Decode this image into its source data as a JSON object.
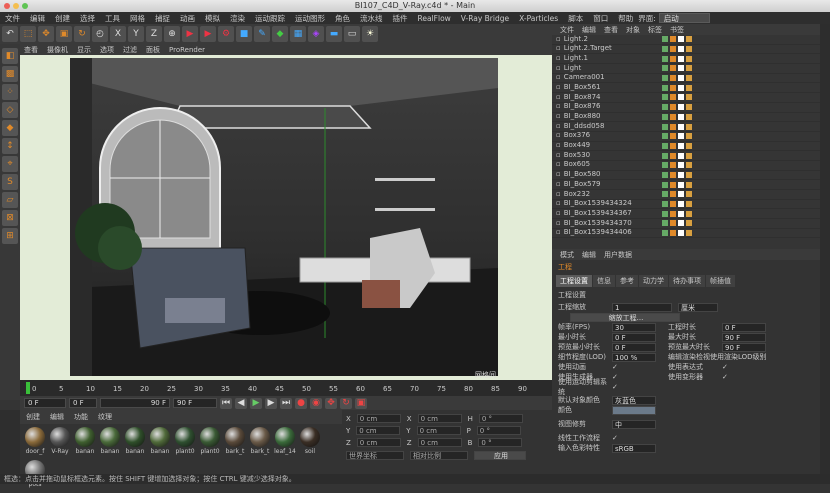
{
  "window": {
    "title": "BI107_C4D_V-Ray.c4d * - Main"
  },
  "menu": {
    "items": [
      "文件",
      "编辑",
      "创建",
      "选择",
      "工具",
      "网格",
      "捕捉",
      "动画",
      "模拟",
      "渲染",
      "运动跟踪",
      "运动图形",
      "角色",
      "流水线",
      "插件",
      "RealFlow",
      "V-Ray Bridge",
      "X-Particles",
      "脚本",
      "窗口",
      "帮助"
    ],
    "layout_label": "界面:",
    "layout_value": "启动"
  },
  "viewport": {
    "menu": [
      "查看",
      "摄像机",
      "显示",
      "选项",
      "过滤",
      "面板",
      "ProRender"
    ],
    "watermark": "网格间"
  },
  "timeline": {
    "ticks": [
      "0",
      "5",
      "10",
      "15",
      "20",
      "25",
      "30",
      "35",
      "40",
      "45",
      "50",
      "55",
      "60",
      "65",
      "70",
      "75",
      "80",
      "85",
      "90"
    ],
    "start": "0 F",
    "current": "0 F",
    "end": "90 F",
    "end2": "90 F"
  },
  "materials": {
    "menu": [
      "创建",
      "编辑",
      "功能",
      "纹理"
    ],
    "items": [
      {
        "name": "door_f",
        "color": "#8a6a3a"
      },
      {
        "name": "V-Ray",
        "color": "#555"
      },
      {
        "name": "banan",
        "color": "#3f5f2f"
      },
      {
        "name": "banan",
        "color": "#4a6a3a"
      },
      {
        "name": "banan",
        "color": "#2f4f2a"
      },
      {
        "name": "banan",
        "color": "#506a3a"
      },
      {
        "name": "plant0",
        "color": "#2f5030"
      },
      {
        "name": "plant0",
        "color": "#3a5a34"
      },
      {
        "name": "bark_t",
        "color": "#5a4a3a"
      },
      {
        "name": "bark_t",
        "color": "#6a5a48"
      },
      {
        "name": "leaf_14",
        "color": "#3a6a3a"
      },
      {
        "name": "soil",
        "color": "#3a2e24"
      },
      {
        "name": "pots",
        "color": "#777"
      }
    ]
  },
  "coords": {
    "rows": [
      {
        "a": "X",
        "av": "0 cm",
        "b": "X",
        "bv": "0 cm",
        "c": "H",
        "cv": "0 °"
      },
      {
        "a": "Y",
        "av": "0 cm",
        "b": "Y",
        "bv": "0 cm",
        "c": "P",
        "cv": "0 °"
      },
      {
        "a": "Z",
        "av": "0 cm",
        "b": "Z",
        "bv": "0 cm",
        "c": "B",
        "cv": "0 °"
      }
    ],
    "mode1": "世界坐标",
    "mode2": "相对比例",
    "apply": "应用"
  },
  "objects": {
    "menu": [
      "文件",
      "编辑",
      "查看",
      "对象",
      "标签",
      "书签"
    ],
    "items": [
      "Light.2",
      "Light.2.Target",
      "Light.1",
      "Light",
      "Camera001",
      "BI_Box561",
      "BI_Box874",
      "BI_Box876",
      "BI_Box880",
      "BI_ddsd058",
      "Box376",
      "Box449",
      "Box530",
      "Box605",
      "BI_Box580",
      "BI_Box579",
      "Box232",
      "BI_Box1539434324",
      "BI_Box1539434367",
      "BI_Box1539434370",
      "BI_Box1539434406"
    ]
  },
  "attributes": {
    "menu": [
      "模式",
      "编辑",
      "用户数据"
    ],
    "header": "工程",
    "tabs": [
      "工程设置",
      "信息",
      "参考",
      "动力学",
      "待办事项",
      "帧插值"
    ],
    "section": "工程设置",
    "scale_label": "工程缩放",
    "scale_value": "1",
    "scale_unit": "厘米",
    "scale_button": "缩放工程...",
    "fields_left": [
      {
        "label": "帧率(FPS)",
        "value": "30"
      },
      {
        "label": "最小时长",
        "value": "0 F"
      },
      {
        "label": "预览最小时长",
        "value": "0 F"
      }
    ],
    "fields_right": [
      {
        "label": "工程时长",
        "value": "0 F"
      },
      {
        "label": "最大时长",
        "value": "90 F"
      },
      {
        "label": "预览最大时长",
        "value": "90 F"
      }
    ],
    "lod_label": "细节程度(LOD)",
    "lod_value": "100 %",
    "lod_right": "编辑渲染检视使用渲染LOD级别",
    "checks_left": [
      "使用动画",
      "使用生成器",
      "使用运动剪辑系统"
    ],
    "checks_right": [
      "使用表达式",
      "使用变形器"
    ],
    "default_color_label": "默认对象颜色",
    "default_color_value": "灰蓝色",
    "color_label": "颜色",
    "view_clip_label": "视图修剪",
    "view_clip_value": "中",
    "linear_label": "线性工作流程",
    "input_color_label": "输入色彩特性",
    "input_color_value": "sRGB"
  },
  "status": {
    "text": "框选：点击并拖动鼠标框选元素。按住 SHIFT 键增加选择对象；按住 CTRL 键减少选择对象。"
  }
}
